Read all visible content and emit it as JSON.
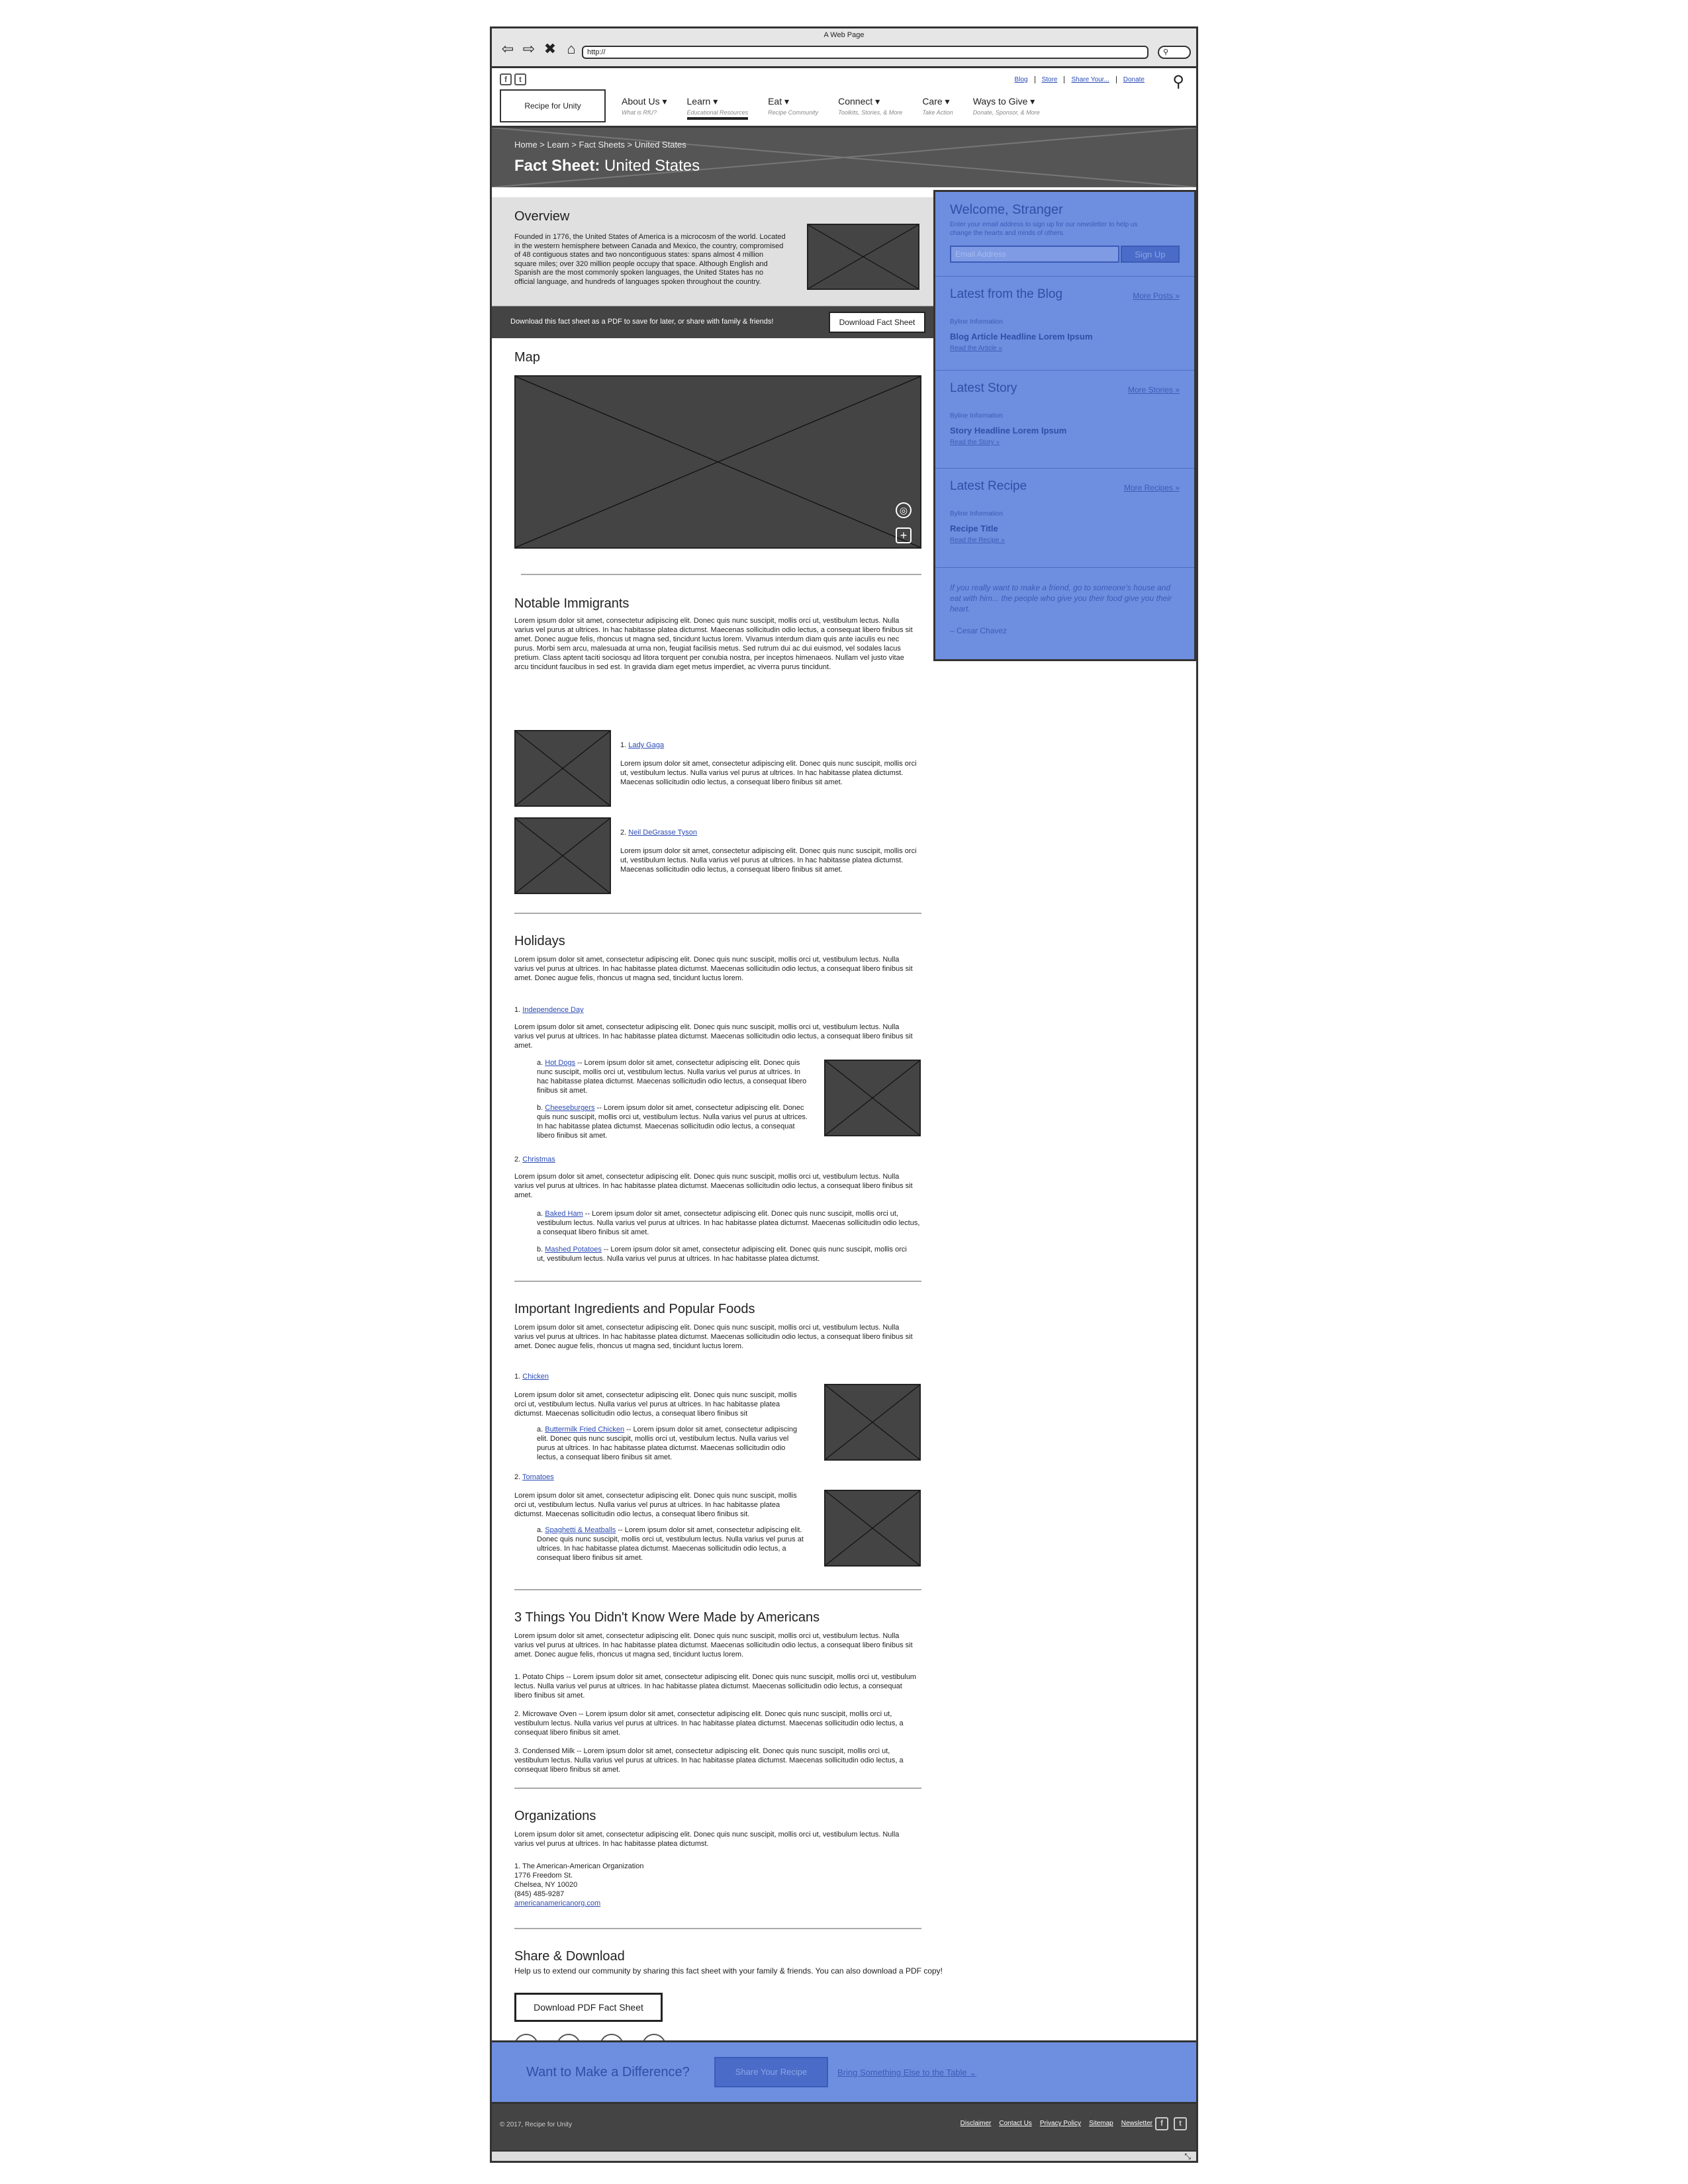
{
  "browser": {
    "title": "A Web Page",
    "url": "http://"
  },
  "header": {
    "util_links": [
      "Blog",
      "Store",
      "Share Your...",
      "Donate"
    ],
    "logo": "Recipe for Unity",
    "nav": [
      {
        "label": "About Us ▾",
        "sub": "What is RfU?"
      },
      {
        "label": "Learn ▾",
        "sub": "Educational Resources"
      },
      {
        "label": "Eat ▾",
        "sub": "Recipe Community"
      },
      {
        "label": "Connect ▾",
        "sub": "Toolkits, Stories, & More"
      },
      {
        "label": "Care ▾",
        "sub": "Take Action"
      },
      {
        "label": "Ways to Give ▾",
        "sub": "Donate, Sponsor, & More"
      }
    ]
  },
  "hero": {
    "breadcrumb": "Home > Learn > Fact Sheets > United States",
    "title_prefix": "Fact Sheet:",
    "title_rest": " United States"
  },
  "overview": {
    "title": "Overview",
    "text": "Founded in 1776, the United States of America is a microcosm of the world. Located in the western hemisphere between Canada and Mexico, the country, compromised of 48 contiguous states and two noncontiguous states: spans almost 4 million square miles; over 320 million people occupy that space. Although English and Spanish are the most commonly spoken languages, the United States has no official language, and hundreds of languages spoken throughout the country."
  },
  "download_bar": {
    "text": "Download this fact sheet as a PDF to save for later, or share with family & friends!",
    "button": "Download Fact Sheet"
  },
  "sidebar": {
    "welcome_title": "Welcome, Stranger",
    "welcome_text": "Enter your email address to sign up for our newsletter to help us change the hearts and minds of others.",
    "email_placeholder": "Email Address",
    "signup": "Sign Up",
    "blog": {
      "title": "Latest from the Blog",
      "more": "More Posts »",
      "byline": "Byline Information",
      "headline": "Blog Article Headline Lorem Ipsum",
      "read": "Read the Article »"
    },
    "story": {
      "title": "Latest Story",
      "more": "More Stories »",
      "byline": "Byline Information",
      "headline": "Story Headline Lorem Ipsum",
      "read": "Read the Story »"
    },
    "recipe": {
      "title": "Latest Recipe",
      "more": "More Recipes »",
      "byline": "Byline Information",
      "headline": "Recipe Title",
      "read": "Read the Recipe »"
    },
    "quote": "If you really want to make a friend, go to someone's house and eat with him... the people who give you their food give you their heart.",
    "quote_author": "– Cesar Chavez"
  },
  "map": {
    "title": "Map"
  },
  "immigrants": {
    "title": "Notable Immigrants",
    "text": "Lorem ipsum dolor sit amet, consectetur adipiscing elit. Donec quis nunc suscipit, mollis orci ut, vestibulum lectus. Nulla varius vel purus at ultrices. In hac habitasse platea dictumst. Maecenas sollicitudin odio lectus, a consequat libero finibus sit amet. Donec augue felis, rhoncus ut magna sed, tincidunt luctus lorem. Vivamus interdum diam quis ante iaculis eu nec purus. Morbi sem arcu, malesuada at urna non, feugiat facilisis metus. Sed rutrum dui ac dui euismod, vel sodales lacus pretium. Class aptent taciti sociosqu ad litora torquent per conubia nostra, per inceptos himenaeos. Nullam vel justo vitae arcu tincidunt faucibus in sed est. In gravida diam eget metus imperdiet, ac viverra purus tincidunt.",
    "items": [
      {
        "num": "1.",
        "name": "Lady Gaga",
        "text": "Lorem ipsum dolor sit amet, consectetur adipiscing elit. Donec quis nunc suscipit, mollis orci ut, vestibulum lectus. Nulla varius vel purus at ultrices. In hac habitasse platea dictumst. Maecenas sollicitudin odio lectus, a consequat libero finibus sit amet."
      },
      {
        "num": "2.",
        "name": "Neil DeGrasse Tyson",
        "text": "Lorem ipsum dolor sit amet, consectetur adipiscing elit. Donec quis nunc suscipit, mollis orci ut, vestibulum lectus. Nulla varius vel purus at ultrices. In hac habitasse platea dictumst. Maecenas sollicitudin odio lectus, a consequat libero finibus sit amet."
      }
    ]
  },
  "holidays": {
    "title": "Holidays",
    "text": "Lorem ipsum dolor sit amet, consectetur adipiscing elit. Donec quis nunc suscipit, mollis orci ut, vestibulum lectus. Nulla varius vel purus at ultrices. In hac habitasse platea dictumst. Maecenas sollicitudin odio lectus, a consequat libero finibus sit amet. Donec augue felis, rhoncus ut magna sed, tincidunt luctus lorem.",
    "h1": {
      "num": "1.",
      "name": "Independence Day",
      "text": "Lorem ipsum dolor sit amet, consectetur adipiscing elit. Donec quis nunc suscipit, mollis orci ut, vestibulum lectus. Nulla varius vel purus at ultrices. In hac habitasse platea dictumst. Maecenas sollicitudin odio lectus, a consequat libero finibus sit amet."
    },
    "h1a": {
      "num": "a.",
      "name": "Hot Dogs",
      "text": " -- Lorem ipsum dolor sit amet, consectetur adipiscing elit. Donec quis nunc suscipit, mollis orci ut, vestibulum lectus. Nulla varius vel purus at ultrices. In hac habitasse platea dictumst. Maecenas sollicitudin odio lectus, a consequat libero finibus sit amet."
    },
    "h1b": {
      "num": "b.",
      "name": "Cheeseburgers",
      "text": " -- Lorem ipsum dolor sit amet, consectetur adipiscing elit. Donec quis nunc suscipit, mollis orci ut, vestibulum lectus. Nulla varius vel purus at ultrices. In hac habitasse platea dictumst. Maecenas sollicitudin odio lectus, a consequat libero finibus sit amet."
    },
    "h2": {
      "num": "2.",
      "name": "Christmas",
      "text": "Lorem ipsum dolor sit amet, consectetur adipiscing elit. Donec quis nunc suscipit, mollis orci ut, vestibulum lectus. Nulla varius vel purus at ultrices. In hac habitasse platea dictumst. Maecenas sollicitudin odio lectus, a consequat libero finibus sit amet."
    },
    "h2a": {
      "num": "a.",
      "name": "Baked Ham",
      "text": " -- Lorem ipsum dolor sit amet, consectetur adipiscing elit. Donec quis nunc suscipit, mollis orci ut, vestibulum lectus. Nulla varius vel purus at ultrices. In hac habitasse platea dictumst. Maecenas sollicitudin odio lectus, a consequat libero finibus sit amet."
    },
    "h2b": {
      "num": "b.",
      "name": "Mashed Potatoes",
      "text": " -- Lorem ipsum dolor sit amet, consectetur adipiscing elit. Donec quis nunc suscipit, mollis orci ut, vestibulum lectus. Nulla varius vel purus at ultrices. In hac habitasse platea dictumst."
    }
  },
  "ingredients": {
    "title": "Important Ingredients and Popular Foods",
    "text": "Lorem ipsum dolor sit amet, consectetur adipiscing elit. Donec quis nunc suscipit, mollis orci ut, vestibulum lectus. Nulla varius vel purus at ultrices. In hac habitasse platea dictumst. Maecenas sollicitudin odio lectus, a consequat libero finibus sit amet. Donec augue felis, rhoncus ut magna sed, tincidunt luctus lorem.",
    "i1": {
      "num": "1.",
      "name": "Chicken",
      "text": "Lorem ipsum dolor sit amet, consectetur adipiscing elit. Donec quis nunc suscipit, mollis orci ut, vestibulum lectus. Nulla varius vel purus at ultrices. In hac habitasse platea dictumst. Maecenas sollicitudin odio lectus, a consequat libero finibus sit"
    },
    "i1a": {
      "num": "a.",
      "name": "Buttermilk Fried Chicken",
      "text": " -- Lorem ipsum dolor sit amet, consectetur adipiscing elit. Donec quis nunc suscipit, mollis orci ut, vestibulum lectus. Nulla varius vel purus at ultrices. In hac habitasse platea dictumst. Maecenas sollicitudin odio lectus, a consequat libero finibus sit amet."
    },
    "i2": {
      "num": "2.",
      "name": "Tomatoes",
      "text": "Lorem ipsum dolor sit amet, consectetur adipiscing elit. Donec quis nunc suscipit, mollis orci ut, vestibulum lectus. Nulla varius vel purus at ultrices. In hac habitasse platea dictumst. Maecenas sollicitudin odio lectus, a consequat libero finibus sit."
    },
    "i2a": {
      "num": "a.",
      "name": "Spaghetti & Meatballs",
      "text": " -- Lorem ipsum dolor sit amet, consectetur adipiscing elit. Donec quis nunc suscipit, mollis orci ut, vestibulum lectus. Nulla varius vel purus at ultrices. In hac habitasse platea dictumst. Maecenas sollicitudin odio lectus, a consequat libero finibus sit amet."
    }
  },
  "things": {
    "title": "3 Things You Didn't Know Were Made by Americans",
    "text": "Lorem ipsum dolor sit amet, consectetur adipiscing elit. Donec quis nunc suscipit, mollis orci ut, vestibulum lectus. Nulla varius vel purus at ultrices. In hac habitasse platea dictumst. Maecenas sollicitudin odio lectus, a consequat libero finibus sit amet. Donec augue felis, rhoncus ut magna sed, tincidunt luctus lorem.",
    "t1": "1. Potato Chips -- Lorem ipsum dolor sit amet, consectetur adipiscing elit. Donec quis nunc suscipit, mollis orci ut, vestibulum lectus. Nulla varius vel purus at ultrices. In hac habitasse platea dictumst. Maecenas sollicitudin odio lectus, a consequat libero finibus sit amet.",
    "t2": "2. Microwave Oven -- Lorem ipsum dolor sit amet, consectetur adipiscing elit. Donec quis nunc suscipit, mollis orci ut, vestibulum lectus. Nulla varius vel purus at ultrices. In hac habitasse platea dictumst. Maecenas sollicitudin odio lectus, a consequat libero finibus sit amet.",
    "t3": "3. Condensed Milk -- Lorem ipsum dolor sit amet, consectetur adipiscing elit. Donec quis nunc suscipit, mollis orci ut, vestibulum lectus. Nulla varius vel purus at ultrices. In hac habitasse platea dictumst. Maecenas sollicitudin odio lectus, a consequat libero finibus sit amet."
  },
  "orgs": {
    "title": "Organizations",
    "text": "Lorem ipsum dolor sit amet, consectetur adipiscing elit. Donec quis nunc suscipit, mollis orci ut, vestibulum lectus. Nulla varius vel purus at ultrices. In hac habitasse platea dictumst.",
    "name": "1. The American-American Organization",
    "street": "1776 Freedom St.",
    "city": "Chelsea, NY 10020",
    "phone": "(845) 485-9287",
    "web": "americanamericanorg.com"
  },
  "share": {
    "title": "Share & Download",
    "text": "Help us to extend our community by sharing this fact sheet with your family & friends. You can also download a PDF copy!",
    "button": "Download PDF Fact Sheet"
  },
  "cta": {
    "text": "Want to Make a Difference?",
    "button": "Share Your Recipe",
    "link": "Bring Something Else to the Table ⌄"
  },
  "footer": {
    "copyright": "© 2017, Recipe for Unity",
    "links": [
      "Disclaimer",
      "Contact Us",
      "Privacy Policy",
      "Sitemap",
      "Newsletter"
    ]
  }
}
